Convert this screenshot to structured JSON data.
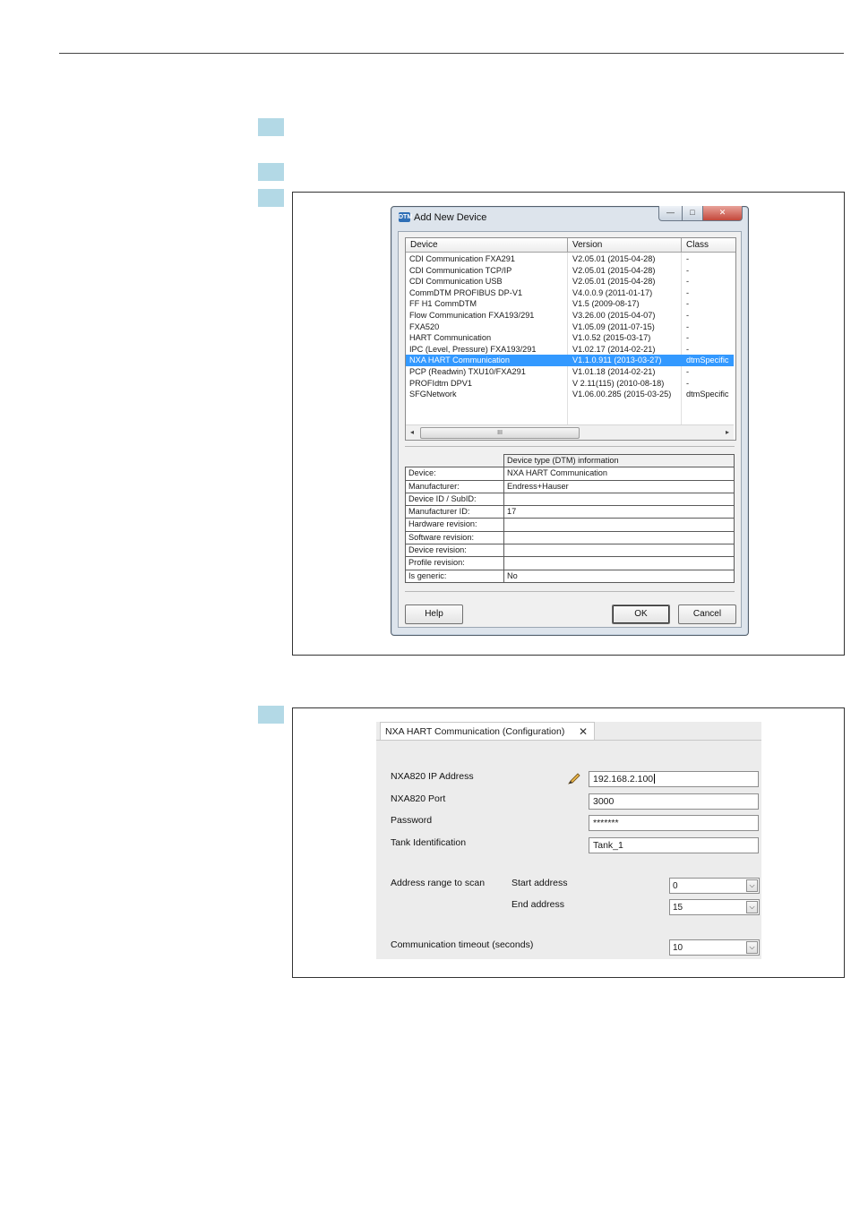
{
  "dialog": {
    "title": "Add New Device",
    "window_buttons": {
      "minimize": "—",
      "maximize": "□",
      "close": "✕"
    },
    "columns": [
      "Device",
      "Version",
      "Class"
    ],
    "devices": [
      {
        "device": "CDI Communication FXA291",
        "version": "V2.05.01 (2015-04-28)",
        "class": "-"
      },
      {
        "device": "CDI Communication TCP/IP",
        "version": "V2.05.01 (2015-04-28)",
        "class": "-"
      },
      {
        "device": "CDI Communication USB",
        "version": "V2.05.01 (2015-04-28)",
        "class": "-"
      },
      {
        "device": "CommDTM PROFIBUS DP-V1",
        "version": "V4.0.0.9 (2011-01-17)",
        "class": "-"
      },
      {
        "device": "FF H1 CommDTM",
        "version": "V1.5 (2009-08-17)",
        "class": "-"
      },
      {
        "device": "Flow Communication FXA193/291",
        "version": "V3.26.00 (2015-04-07)",
        "class": "-"
      },
      {
        "device": "FXA520",
        "version": "V1.05.09 (2011-07-15)",
        "class": "-"
      },
      {
        "device": "HART Communication",
        "version": "V1.0.52 (2015-03-17)",
        "class": "-"
      },
      {
        "device": "IPC (Level, Pressure) FXA193/291",
        "version": "V1.02.17 (2014-02-21)",
        "class": "-"
      },
      {
        "device": "NXA HART Communication",
        "version": "V1.1.0.911 (2013-03-27)",
        "class": "dtmSpecific",
        "selected": true
      },
      {
        "device": "PCP (Readwin) TXU10/FXA291",
        "version": "V1.01.18 (2014-02-21)",
        "class": "-"
      },
      {
        "device": "PROFIdtm DPV1",
        "version": "V 2.11(115) (2010-08-18)",
        "class": "-"
      },
      {
        "device": "SFGNetwork",
        "version": "V1.06.00.285 (2015-03-25)",
        "class": "dtmSpecific"
      }
    ],
    "scrollbar": {
      "left": "◂",
      "right": "▸",
      "grip": "III"
    },
    "info_header": "Device type (DTM) information",
    "info": [
      {
        "key": "Device:",
        "value": "NXA HART Communication"
      },
      {
        "key": "Manufacturer:",
        "value": "Endress+Hauser"
      },
      {
        "key": "Device ID / SubID:",
        "value": ""
      },
      {
        "key": "Manufacturer ID:",
        "value": "17"
      },
      {
        "key": "Hardware revision:",
        "value": ""
      },
      {
        "key": "Software revision:",
        "value": ""
      },
      {
        "key": "Device revision:",
        "value": ""
      },
      {
        "key": "Profile revision:",
        "value": ""
      },
      {
        "key": "Is generic:",
        "value": "No"
      }
    ],
    "buttons": {
      "help": "Help",
      "ok": "OK",
      "cancel": "Cancel"
    }
  },
  "config": {
    "tab_title": "NXA HART Communication  (Configuration)",
    "tab_close": "✕",
    "ip_label": "NXA820 IP Address",
    "ip_value": "192.168.2.100",
    "port_label": "NXA820 Port",
    "port_value": "3000",
    "password_label": "Password",
    "password_value": "*******",
    "tank_label": "Tank Identification",
    "tank_value": "Tank_1",
    "range_label": "Address range to scan",
    "start_label": "Start address",
    "start_value": "0",
    "end_label": "End address",
    "end_value": "15",
    "timeout_label": "Communication timeout (seconds)",
    "timeout_value": "10",
    "dropdown_glyph": "⌵"
  }
}
